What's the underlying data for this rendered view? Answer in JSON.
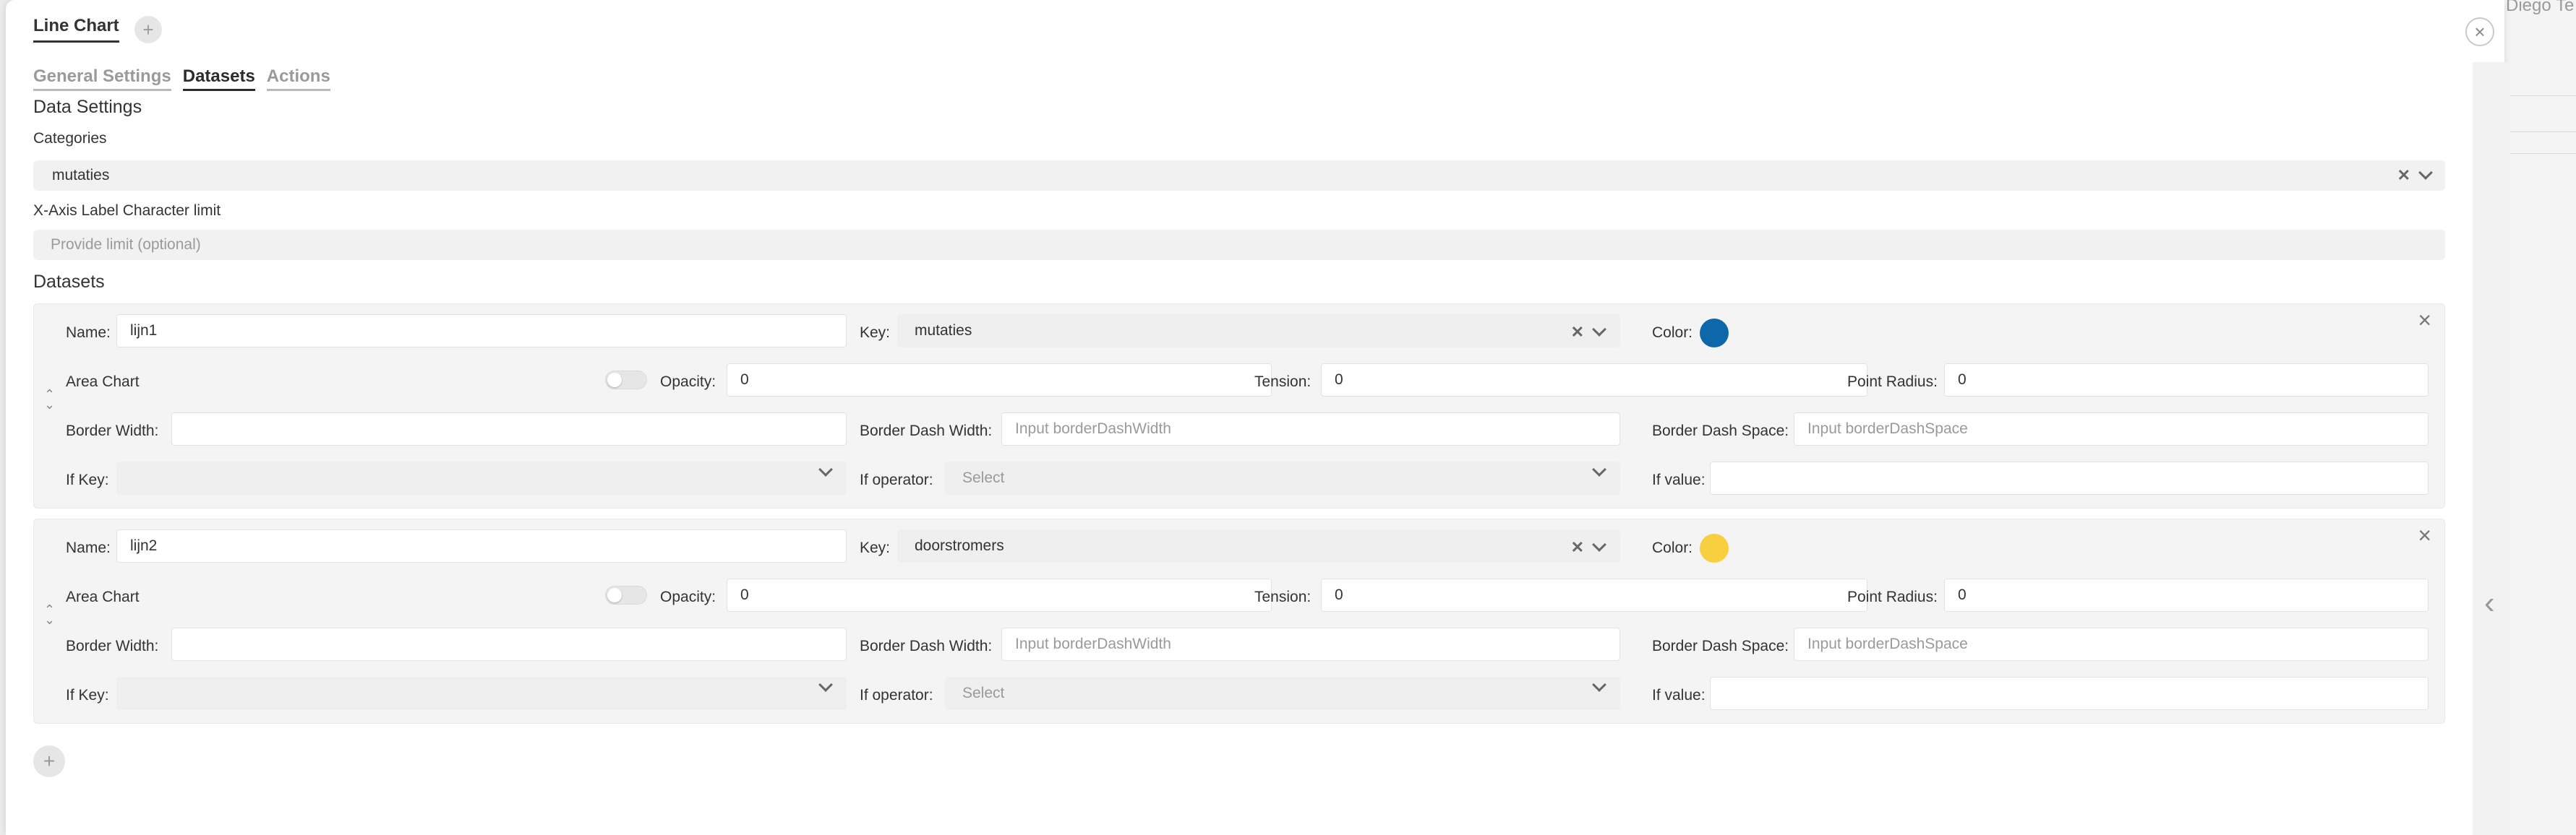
{
  "background": {
    "user_name": "Diego Te"
  },
  "modal": {
    "title": "Line Chart",
    "add_tab_icon": "+",
    "close_icon": "×"
  },
  "tabs": [
    {
      "label": "General Settings",
      "active": false
    },
    {
      "label": "Datasets",
      "active": true
    },
    {
      "label": "Actions",
      "active": false
    }
  ],
  "data_settings": {
    "heading": "Data Settings",
    "categories_label": "Categories",
    "categories_value": "mutaties",
    "xaxis_limit_label": "X-Axis Label Character limit",
    "xaxis_limit_placeholder": "Provide limit (optional)"
  },
  "datasets_heading": "Datasets",
  "field_labels": {
    "name": "Name:",
    "key": "Key:",
    "color": "Color:",
    "area_chart": "Area Chart",
    "opacity": "Opacity:",
    "tension": "Tension:",
    "point_radius": "Point Radius:",
    "border_width": "Border Width:",
    "border_dash_width": "Border Dash Width:",
    "border_dash_space": "Border Dash Space:",
    "if_key": "If Key:",
    "if_operator": "If operator:",
    "if_value": "If value:"
  },
  "datasets": [
    {
      "name": "lijn1",
      "key": "mutaties",
      "color": "#0e67a8",
      "area_chart": false,
      "opacity": "0",
      "tension": "0",
      "point_radius": "0",
      "border_width": "",
      "border_dash_width_placeholder": "Input borderDashWidth",
      "border_dash_space_placeholder": "Input borderDashSpace",
      "if_key": "",
      "if_operator_placeholder": "Select",
      "if_value": ""
    },
    {
      "name": "lijn2",
      "key": "doorstromers",
      "color": "#f7cf3f",
      "area_chart": false,
      "opacity": "0",
      "tension": "0",
      "point_radius": "0",
      "border_width": "",
      "border_dash_width_placeholder": "Input borderDashWidth",
      "border_dash_space_placeholder": "Input borderDashSpace",
      "if_key": "",
      "if_operator_placeholder": "Select",
      "if_value": ""
    }
  ],
  "add_dataset_icon": "+"
}
